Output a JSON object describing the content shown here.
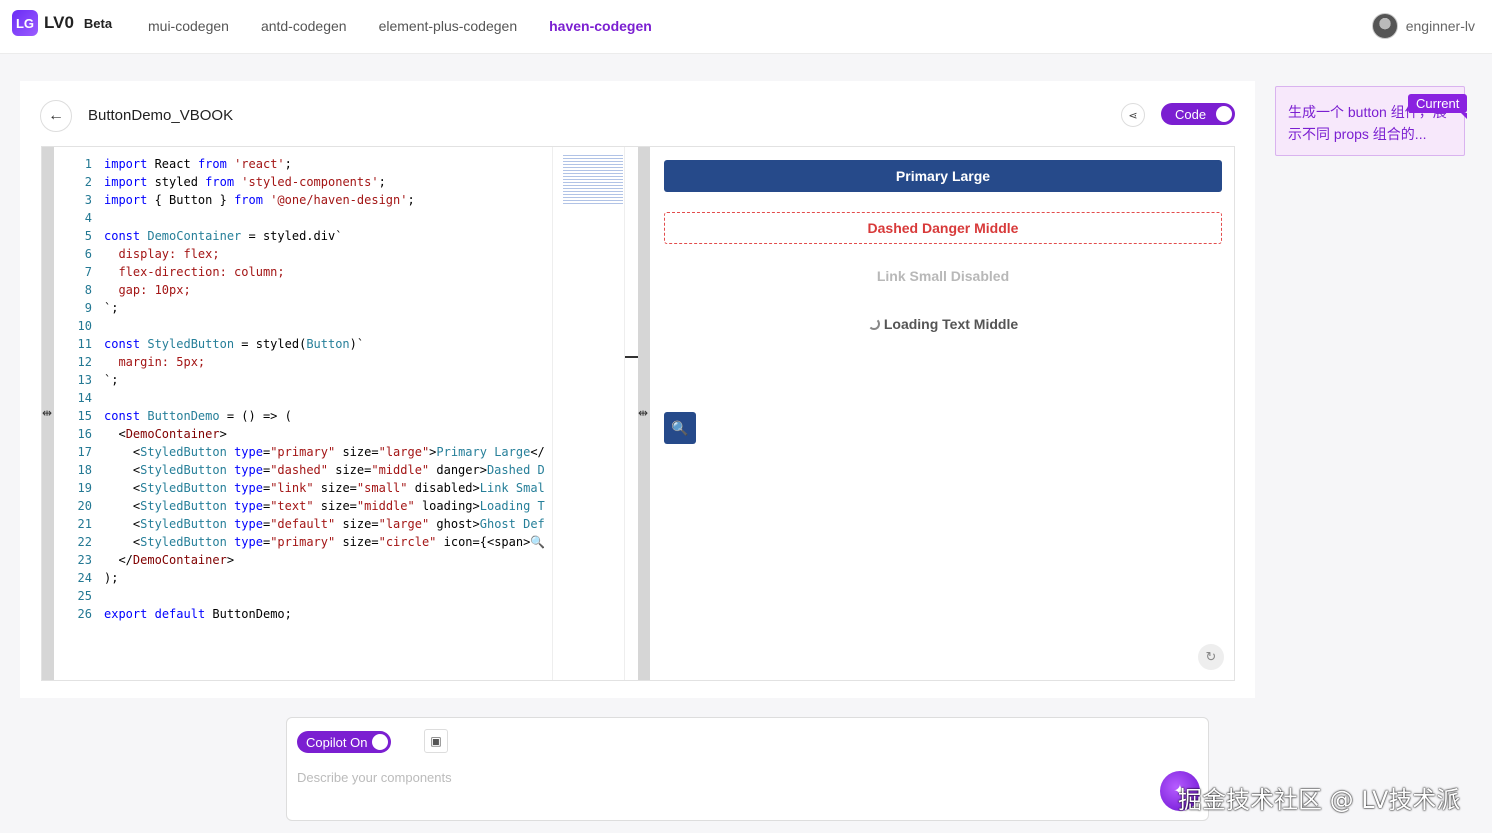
{
  "brand": {
    "logo_mark": "LG",
    "name": "LV0",
    "badge": "Beta"
  },
  "nav": {
    "items": [
      {
        "label": "mui-codegen",
        "active": false
      },
      {
        "label": "antd-codegen",
        "active": false
      },
      {
        "label": "element-plus-codegen",
        "active": false
      },
      {
        "label": "haven-codegen",
        "active": true
      }
    ]
  },
  "user": {
    "name": "enginner-lv",
    "icon": "avatar"
  },
  "project": {
    "title": "ButtonDemo_VBOOK",
    "back_icon": "arrow-left-icon",
    "share_icon": "share-icon",
    "code_toggle_label": "Code",
    "code_toggle_on": true
  },
  "editor": {
    "line_numbers": [
      "1",
      "2",
      "3",
      "4",
      "5",
      "6",
      "7",
      "8",
      "9",
      "10",
      "11",
      "12",
      "13",
      "14",
      "15",
      "16",
      "17",
      "18",
      "19",
      "20",
      "21",
      "22",
      "23",
      "24",
      "25",
      "26"
    ]
  },
  "preview": {
    "buttons": {
      "primary_large": "Primary Large",
      "dashed_danger": "Dashed Danger Middle",
      "link_disabled": "Link Small Disabled",
      "loading_text": "Loading Text Middle"
    },
    "icon_button_glyph": "🔍",
    "refresh_icon": "refresh-icon"
  },
  "history": {
    "text": "生成一个 button 组件，展示不同 props 组合的...",
    "badge": "Current"
  },
  "prompt": {
    "copilot_label": "Copilot On",
    "copilot_on": true,
    "placeholder": "Describe your components",
    "image_icon": "image-icon",
    "send_icon": "magic-wand-icon"
  },
  "watermark": "掘金技术社区 @ LV技术派",
  "colors": {
    "accent": "#7b1fd1",
    "primary_button": "#264a8a",
    "danger": "#d83a3a"
  }
}
